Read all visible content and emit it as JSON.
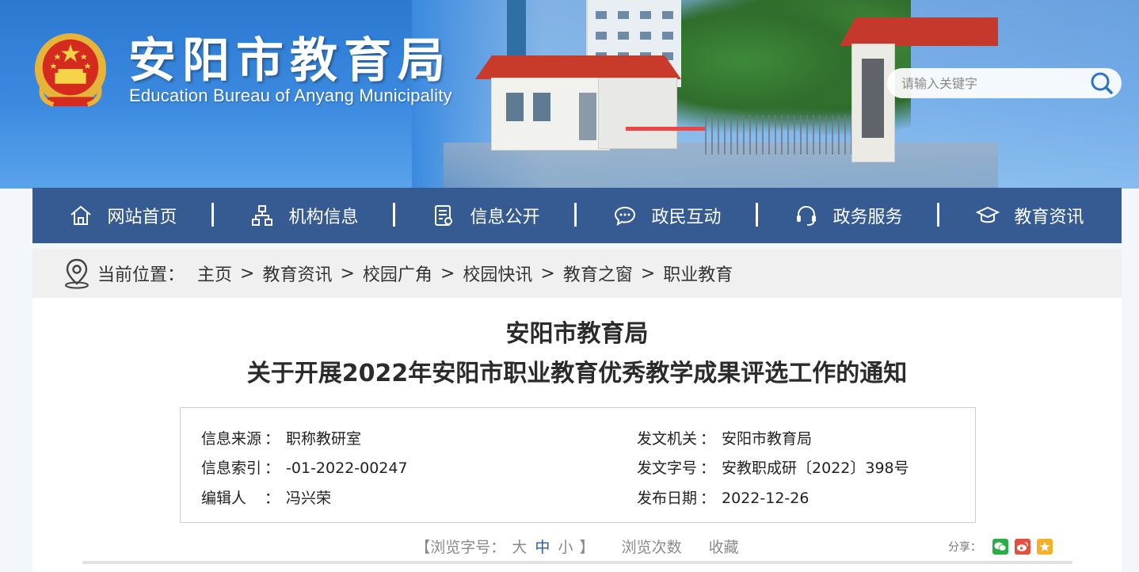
{
  "header": {
    "title": "安阳市教育局",
    "subtitle": "Education Bureau of Anyang Municipality",
    "search": {
      "placeholder": "请输入关键字"
    }
  },
  "nav": {
    "items": [
      {
        "label": "网站首页",
        "icon": "home-icon"
      },
      {
        "label": "机构信息",
        "icon": "org-chart-icon"
      },
      {
        "label": "信息公开",
        "icon": "document-icon"
      },
      {
        "label": "政民互动",
        "icon": "chat-icon"
      },
      {
        "label": "政务服务",
        "icon": "headset-icon"
      },
      {
        "label": "教育资讯",
        "icon": "graduation-cap-icon"
      }
    ]
  },
  "breadcrumb": {
    "lead": "当前位置：",
    "items": [
      "主页",
      "教育资讯",
      "校园广角",
      "校园快讯",
      "教育之窗",
      "职业教育"
    ],
    "separator": ">"
  },
  "article": {
    "title_line1": "安阳市教育局",
    "title_line2": "关于开展2022年安阳市职业教育优秀教学成果评选工作的通知"
  },
  "meta": {
    "source_label": "信息来源",
    "source_value": "职称教研室",
    "index_label": "信息索引",
    "index_value": "-01-2022-00247",
    "editor_label": "编辑人",
    "editor_value": "冯兴荣",
    "issuer_label": "发文机关",
    "issuer_value": "安阳市教育局",
    "docno_label": "发文字号",
    "docno_value": "安教职成研〔2022〕398号",
    "date_label": "发布日期",
    "date_value": "2022-12-26",
    "colon": "："
  },
  "tools": {
    "open_bracket": "【浏览字号：",
    "size_large": "大",
    "size_medium": "中",
    "size_small": "小",
    "close_bracket": "】",
    "views": "浏览次数",
    "favorite": "收藏",
    "share_label": "分享："
  },
  "colors": {
    "nav_bg": "#365b92",
    "header_blue": "#2b78d0",
    "wechat": "#2aae47",
    "weibo": "#e2503f",
    "qzone": "#f3b12a"
  }
}
